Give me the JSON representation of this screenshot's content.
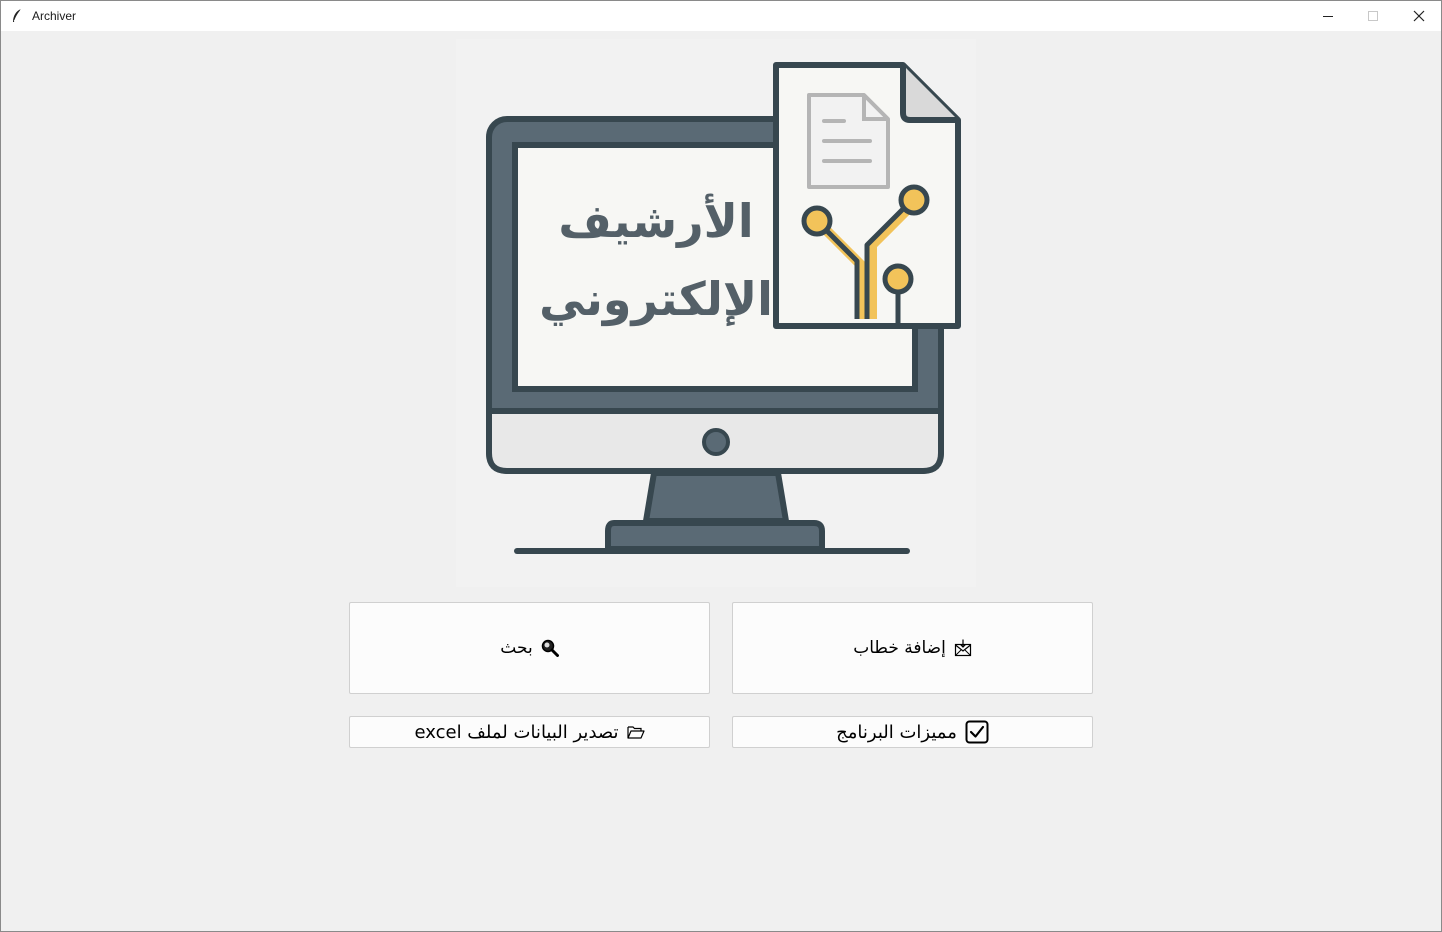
{
  "window": {
    "title": "Archiver",
    "controls": [
      "minimize",
      "maximize",
      "close"
    ]
  },
  "hero": {
    "line1": "الأرشيف",
    "line2": "الإلكتروني",
    "colors": {
      "monitor_frame": "#37474f",
      "monitor_body": "#5a6a75",
      "screen": "#f7f7f4",
      "chin": "#e8e8e8",
      "accent": "#f2c35a",
      "text": "#546068"
    }
  },
  "buttons": {
    "add_letter": {
      "label": "إضافة خطاب",
      "icon": "envelope-icon"
    },
    "search": {
      "label": "بحث",
      "icon": "magnifier-icon"
    },
    "features": {
      "label": "مميزات البرنامج",
      "icon": "checkbox-icon"
    },
    "export_excel": {
      "label": "تصدير البيانات لملف excel",
      "icon": "folder-icon"
    }
  }
}
